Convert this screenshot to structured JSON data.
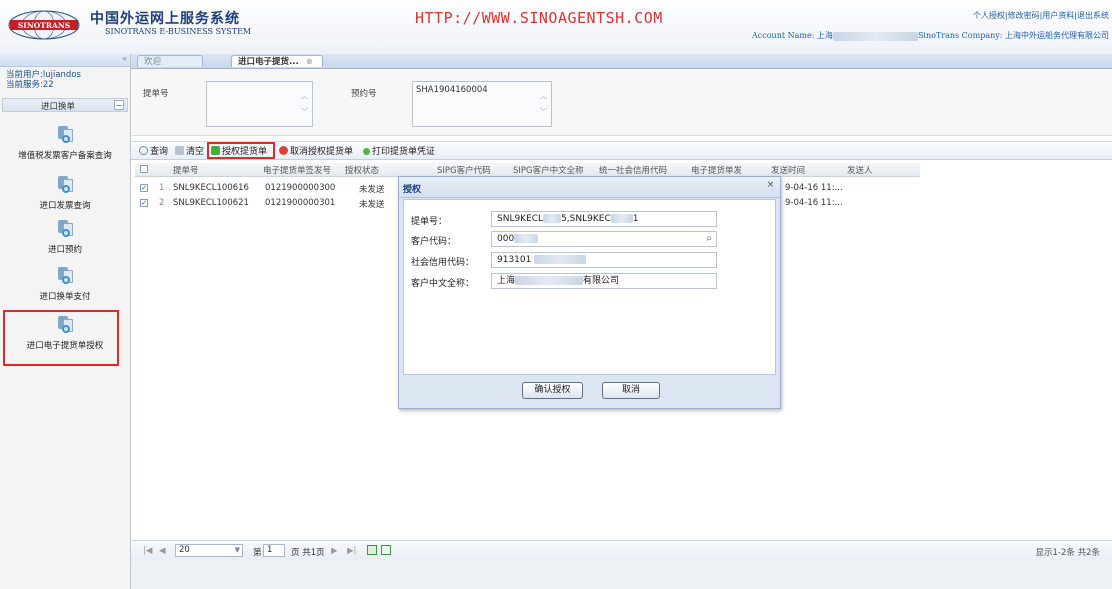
{
  "header": {
    "system_cn": "中国外运网上服务系统",
    "system_en": "SINOTRANS E-BUSINESS SYSTEM",
    "url": "HTTP://WWW.SINOAGENTSH.COM",
    "links": [
      "个人授权",
      "修改密码",
      "用户资料",
      "退出系统"
    ],
    "account_label": "Account Name: 上海",
    "company_label": "SinoTrans Company: 上海中外运船务代理有限公司",
    "logo_text": "SINOTRANS"
  },
  "sidebar": {
    "collapse": "«",
    "current_user": "当前用户:lujiandos",
    "current_service": "当前服务:22",
    "section_title": "进口换单",
    "section_toggle": "−",
    "items": [
      {
        "label": "增值税发票客户备案查询"
      },
      {
        "label": "进口发票查询"
      },
      {
        "label": "进口预约"
      },
      {
        "label": "进口换单支付"
      },
      {
        "label": "进口电子提货单授权"
      }
    ]
  },
  "tabs": [
    {
      "label": "欢迎"
    },
    {
      "label": "进口电子提货..."
    }
  ],
  "form": {
    "bl_label": "提单号",
    "booking_label": "预约号",
    "booking_value": "SHA1904160004",
    "bl_value": ""
  },
  "toolbar": {
    "query": "查询",
    "clear": "清空",
    "authorize": "授权提货单",
    "cancel_auth": "取消授权提货单",
    "print": "打印提货单凭证"
  },
  "grid": {
    "columns": [
      "提单号",
      "电子提货单签发号",
      "授权状态",
      "SIPG客户代码",
      "SIPG客户中文全称",
      "统一社会信用代码",
      "电子提货单发",
      "发送时间",
      "发送人"
    ],
    "rows": [
      {
        "no": "1",
        "bl": "SNL9KECL100616",
        "sign": "0121900000300",
        "status": "未发送",
        "time": "9-04-16 11:..."
      },
      {
        "no": "2",
        "bl": "SNL9KECL100621",
        "sign": "0121900000301",
        "status": "未发送",
        "time": "9-04-16 11:..."
      }
    ]
  },
  "pager": {
    "first": "|◀",
    "prev": "◀",
    "page_size": "20",
    "page_prefix": "第",
    "page_value": "1",
    "page_suffix": "页 共1页",
    "next": "▶",
    "last": "▶|",
    "status": "显示1-2条 共2条"
  },
  "dialog": {
    "title": "授权",
    "close": "×",
    "bl_label": "提单号：",
    "bl_value_a": "SNL9KECL",
    "bl_value_b": "5,SNL9KEC",
    "bl_value_c": "1",
    "cust_code_label": "客户代码：",
    "cust_code_value": "000",
    "credit_label": "社会信用代码：",
    "credit_value": "913101",
    "cust_name_label": "客户中文全称：",
    "cust_name_prefix": "上海",
    "cust_name_suffix": "有限公司",
    "confirm": "确认授权",
    "cancel": "取消"
  },
  "colors": {
    "accent_red": "#e02a2a",
    "header_blue": "#1f3f7a",
    "url_red": "#dd3333"
  }
}
